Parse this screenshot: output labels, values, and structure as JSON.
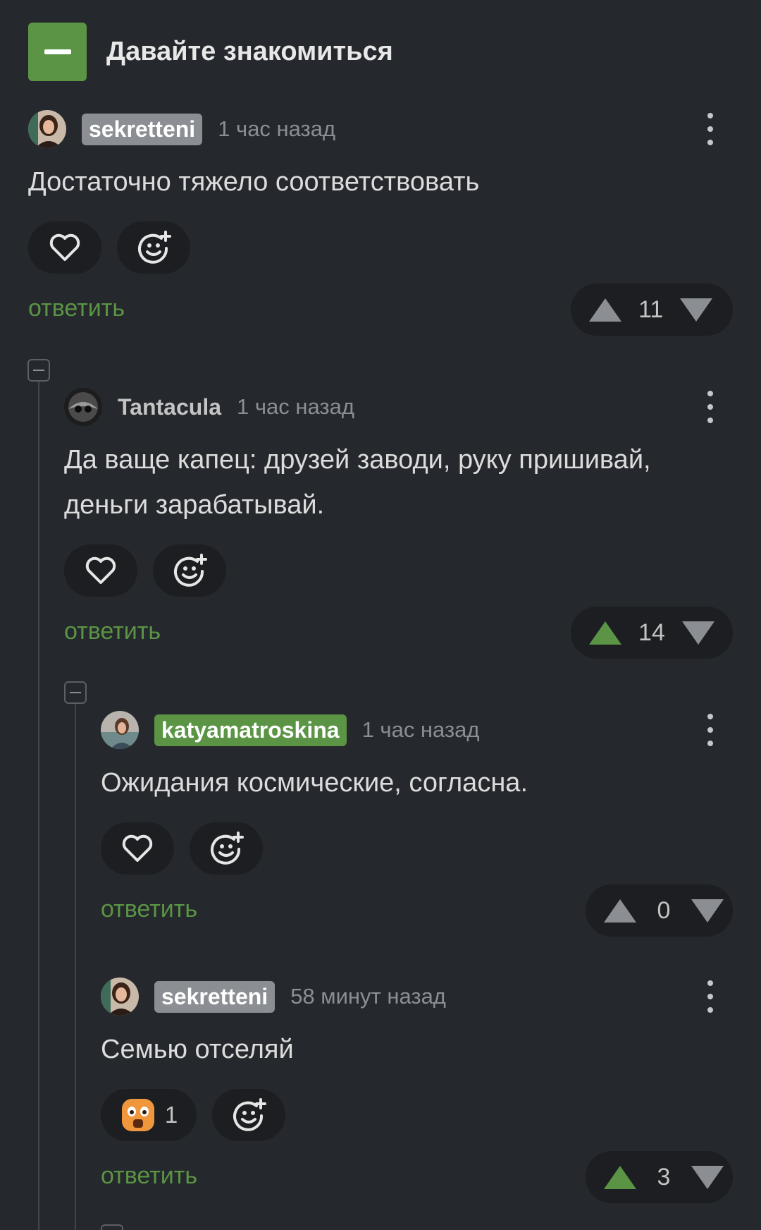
{
  "post": {
    "title": "Давайте знакомиться"
  },
  "comments": [
    {
      "author": "sekretteni",
      "time": "1 час назад",
      "text": "Достаточно тяжело соответствовать",
      "reply": "ответить",
      "votes": "11",
      "reaction_count": ""
    },
    {
      "author": "Tantacula",
      "time": "1 час назад",
      "text": "Да ваще капец: друзей заводи, руку пришивай, деньги зарабатывай.",
      "reply": "ответить",
      "votes": "14",
      "reaction_count": ""
    },
    {
      "author": "katyamatroskina",
      "time": "1 час назад",
      "text": "Ожидания космические, согласна.",
      "reply": "ответить",
      "votes": "0",
      "reaction_count": ""
    },
    {
      "author": "sekretteni",
      "time": "58 минут назад",
      "text": "Семью отселяй",
      "reply": "ответить",
      "votes": "3",
      "reaction_count": "1"
    }
  ],
  "colors": {
    "accent": "#5a9444",
    "background": "#25282c",
    "pill": "#1c1e21",
    "muted": "#8b8f94"
  },
  "icons": [
    "heart-icon",
    "add-emoji-icon",
    "kebab-menu-icon",
    "upvote-icon",
    "downvote-icon",
    "collapse-icon",
    "shocked-emoji-icon"
  ]
}
